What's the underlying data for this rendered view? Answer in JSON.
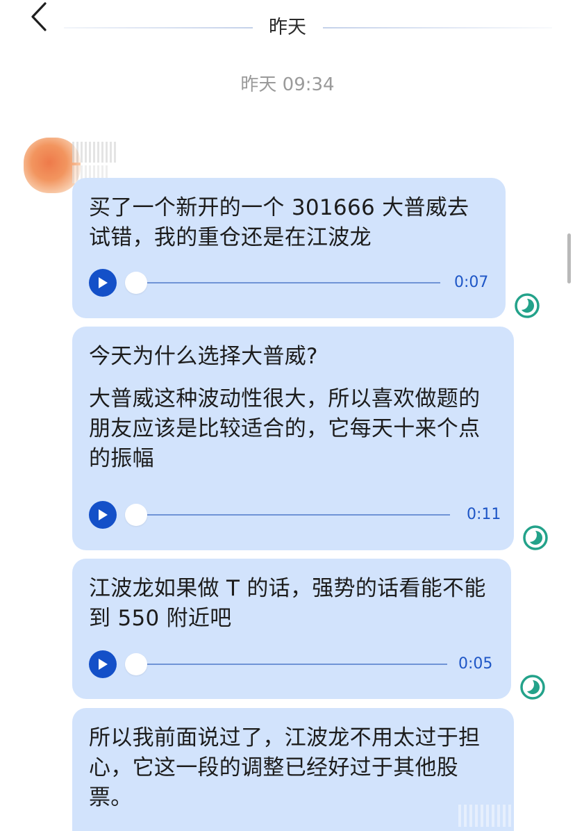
{
  "header": {
    "title": "昨天",
    "back_icon": "chevron-left-icon"
  },
  "timestamp": "昨天 09:34",
  "messages": [
    {
      "text": "买了一个新开的一个 301666 大普威去试错，我的重仓还是在江波龙",
      "duration": "0:07",
      "status_icon": "half-moon-status-icon"
    },
    {
      "text": "今天为什么选择大普威?",
      "text2": "大普威这种波动性很大，所以喜欢做题的朋友应该是比较适合的，它每天十来个点的振幅",
      "duration": "0:11",
      "status_icon": "half-moon-status-icon"
    },
    {
      "text": "江波龙如果做 T 的话，强势的话看能不能到 550 附近吧",
      "duration": "0:05",
      "status_icon": "half-moon-status-icon"
    },
    {
      "text": "所以我前面说过了，江波龙不用太过于担心，它这一段的调整已经好过于其他股票。"
    }
  ],
  "colors": {
    "bubble": "#d2e3fc",
    "play": "#1450c8",
    "status": "#23a28a",
    "duration": "#1e56c6"
  }
}
